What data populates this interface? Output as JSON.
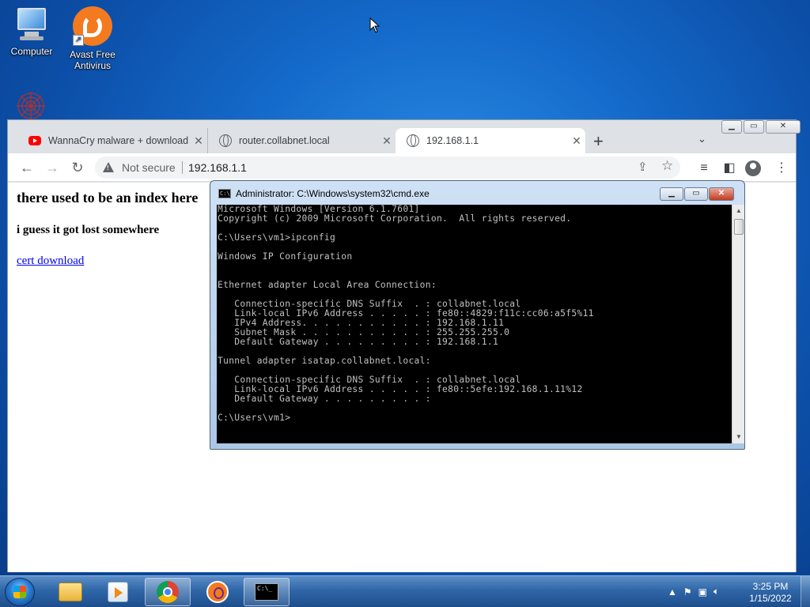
{
  "desktop": {
    "icons": [
      {
        "label": "Computer"
      },
      {
        "label": "Avast Free Antivirus"
      }
    ]
  },
  "browser": {
    "tabs": [
      {
        "title": "WannaCry malware + download",
        "favicon": "youtube-icon"
      },
      {
        "title": "router.collabnet.local",
        "favicon": "globe-icon"
      },
      {
        "title": "192.168.1.1",
        "favicon": "globe-icon",
        "active": true
      }
    ],
    "security_label": "Not secure",
    "url": "192.168.1.1",
    "page": {
      "heading": "there used to be an index here",
      "subheading": "i guess it got lost somewhere",
      "link": "cert download"
    }
  },
  "cmd": {
    "title": "Administrator: C:\\Windows\\system32\\cmd.exe",
    "output": "Microsoft Windows [Version 6.1.7601]\nCopyright (c) 2009 Microsoft Corporation.  All rights reserved.\n\nC:\\Users\\vm1>ipconfig\n\nWindows IP Configuration\n\n\nEthernet adapter Local Area Connection:\n\n   Connection-specific DNS Suffix  . : collabnet.local\n   Link-local IPv6 Address . . . . . : fe80::4829:f11c:cc06:a5f5%11\n   IPv4 Address. . . . . . . . . . . : 192.168.1.11\n   Subnet Mask . . . . . . . . . . . : 255.255.255.0\n   Default Gateway . . . . . . . . . : 192.168.1.1\n\nTunnel adapter isatap.collabnet.local:\n\n   Connection-specific DNS Suffix  . : collabnet.local\n   Link-local IPv6 Address . . . . . : fe80::5efe:192.168.1.11%12\n   Default Gateway . . . . . . . . . :\n\nC:\\Users\\vm1>"
  },
  "taskbar": {
    "clock_time": "3:25 PM",
    "clock_date": "1/15/2022",
    "pinned": [
      "windows-explorer-icon",
      "media-center-icon",
      "chrome-icon",
      "avast-icon",
      "cmd-icon"
    ]
  },
  "colors": {
    "desktop_blue": "#1469c9",
    "link": "#0000ee",
    "console_bg": "#000000",
    "console_fg": "#c0c0c0"
  }
}
